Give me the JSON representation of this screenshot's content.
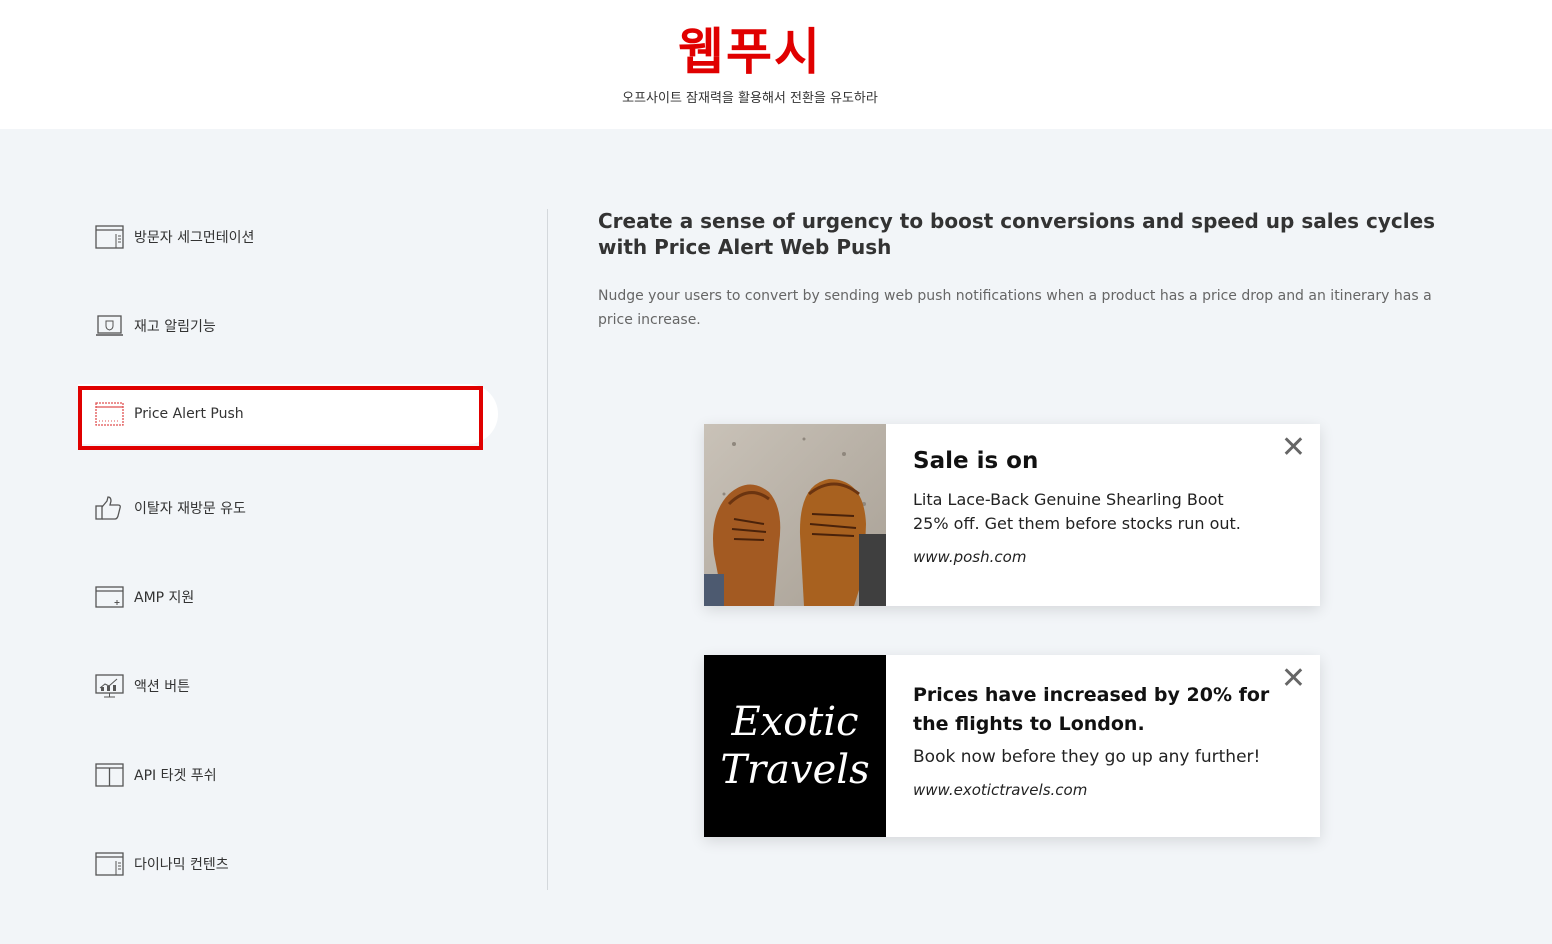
{
  "header": {
    "title": "웹푸시",
    "subtitle": "오프사이트 잠재력을 활용해서 전환을 유도하라"
  },
  "sidebar": {
    "items": [
      {
        "label": "방문자 세그먼테이션",
        "icon": "browser-list-icon"
      },
      {
        "label": "재고 알림기능",
        "icon": "laptop-shield-icon"
      },
      {
        "label": "Price Alert Push",
        "icon": "browser-alert-icon",
        "active": true
      },
      {
        "label": "이탈자 재방문 유도",
        "icon": "thumbs-up-icon"
      },
      {
        "label": "AMP 지원",
        "icon": "browser-plus-icon"
      },
      {
        "label": "액션 버튼",
        "icon": "monitor-chart-icon"
      },
      {
        "label": "API 타겟 푸쉬",
        "icon": "browser-columns-icon"
      },
      {
        "label": "다이나믹 컨텐츠",
        "icon": "browser-list-icon"
      }
    ]
  },
  "content": {
    "title": "Create a sense of urgency to boost conversions and speed up sales cycles with Price Alert Web Push",
    "description": "Nudge your users to convert by sending web push notifications when a product has a price drop and an itinerary has a price increase."
  },
  "notifications": [
    {
      "title": "Sale is on",
      "text_line1": "Lita Lace-Back Genuine Shearling Boot",
      "text_line2": "25% off. Get them before stocks run out.",
      "url": "www.posh.com",
      "close": "✕"
    },
    {
      "title": "Prices have increased by 20% for the flights to London.",
      "text": "Book now before they go up any further!",
      "url": "www.exotictravels.com",
      "logo_line1": "Exotic",
      "logo_line2": "Travels",
      "close": "✕"
    }
  ],
  "colors": {
    "accent": "#e00000",
    "background": "#f2f5f8"
  }
}
